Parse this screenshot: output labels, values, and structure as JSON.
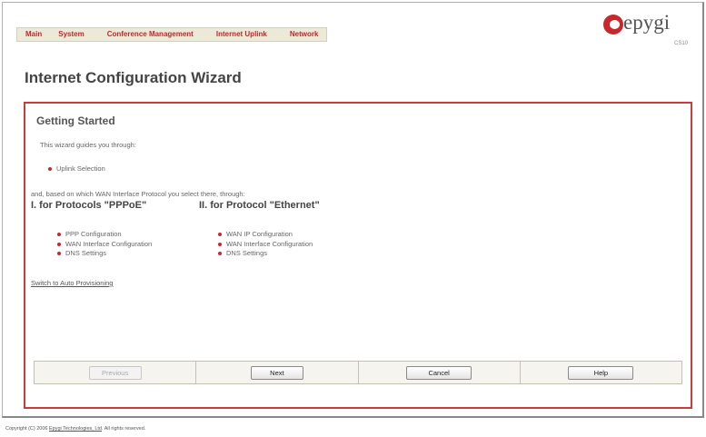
{
  "nav": {
    "items": [
      "Main",
      "System",
      "Conference Management",
      "Internet Uplink",
      "Network"
    ]
  },
  "logo": {
    "text": "epygi",
    "sub": "CS10",
    "color": "#c8272d"
  },
  "page_title": "Internet Configuration Wizard",
  "panel": {
    "title": "Getting Started",
    "intro": "This wizard guides you through:",
    "uplink_items": [
      "Uplink Selection"
    ],
    "and_text": "and, based on which WAN Interface Protocol you select there, through:",
    "protocol_1": {
      "heading": "I. for Protocols \"PPPoE\"",
      "items": [
        "PPP Configuration",
        "WAN Interface Configuration",
        "DNS Settings"
      ]
    },
    "protocol_2": {
      "heading": "II. for Protocol \"Ethernet\"",
      "items": [
        "WAN IP Configuration",
        "WAN Interface Configuration",
        "DNS Settings"
      ]
    },
    "auto_link": "Switch to Auto Provisioning",
    "border_color": "#cc3b3b"
  },
  "buttons": {
    "previous": "Previous",
    "next": "Next",
    "cancel": "Cancel",
    "help": "Help"
  },
  "footer": {
    "prefix": "Copyright (C) 2006 ",
    "link": "Epygi Technologies, Ltd",
    "suffix": ". All rights reserved."
  }
}
